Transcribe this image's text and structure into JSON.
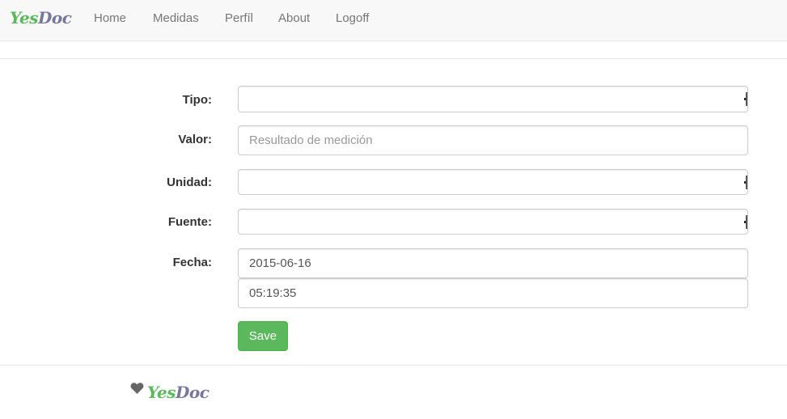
{
  "navbar": {
    "brand_part1": "Yes",
    "brand_part2": "Doc",
    "links": [
      "Home",
      "Medidas",
      "Perfíl",
      "About",
      "Logoff"
    ]
  },
  "form": {
    "tipo_label": "Tipo:",
    "tipo_value": "",
    "valor_label": "Valor:",
    "valor_placeholder": "Resultado de medición",
    "unidad_label": "Unidad:",
    "unidad_value": "",
    "fuente_label": "Fuente:",
    "fuente_value": "",
    "fecha_label": "Fecha:",
    "fecha_date": "2015-06-16",
    "fecha_time": "05:19:35",
    "save_label": "Save"
  },
  "footer": {
    "icon": "heart-icon",
    "brand_part1": "Yes",
    "brand_part2": "Doc"
  },
  "colors": {
    "brand_green": "#5cb85c",
    "brand_doc": "#777799",
    "navbar_bg": "#f8f8f8"
  }
}
